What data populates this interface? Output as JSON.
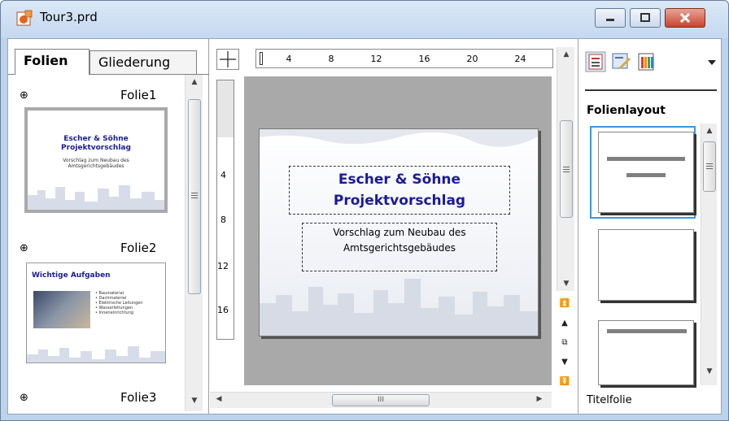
{
  "window": {
    "title": "Tour3.prd"
  },
  "tabs": [
    {
      "label": "Folien"
    },
    {
      "label": "Gliederung"
    }
  ],
  "slides": [
    {
      "name": "Folie1",
      "title_lines": [
        "Escher & Söhne",
        "Projektvorschlag"
      ],
      "subtitle_lines": [
        "Vorschlag zum Neubau des",
        "Amtsgerichtsgebäudes"
      ],
      "selected": true
    },
    {
      "name": "Folie2",
      "heading": "Wichtige Aufgaben",
      "bullets": [
        "Baumaterial",
        "Dachmaterial",
        "Elektrische Leitungen",
        "Wasserleitungen",
        "Inneneinrichtung"
      ],
      "selected": false
    },
    {
      "name": "Folie3",
      "selected": false
    }
  ],
  "ruler": {
    "horizontal_labels": [
      "4",
      "8",
      "12",
      "16",
      "20",
      "24"
    ],
    "vertical_labels": [
      "4",
      "8",
      "12",
      "16"
    ]
  },
  "current_slide": {
    "title_lines": [
      "Escher & Söhne",
      "Projektvorschlag"
    ],
    "subtitle_lines": [
      "Vorschlag zum Neubau des",
      "Amtsgerichtsgebäudes"
    ]
  },
  "task_pane": {
    "title": "Folienlayout",
    "selected_layout": "Titelfolie"
  },
  "colors": {
    "title_blue": "#1a1a9a",
    "selection_blue": "#3a96e0",
    "close_red": "#c7452d"
  },
  "scroll": {
    "hscroll_grip": "III"
  }
}
